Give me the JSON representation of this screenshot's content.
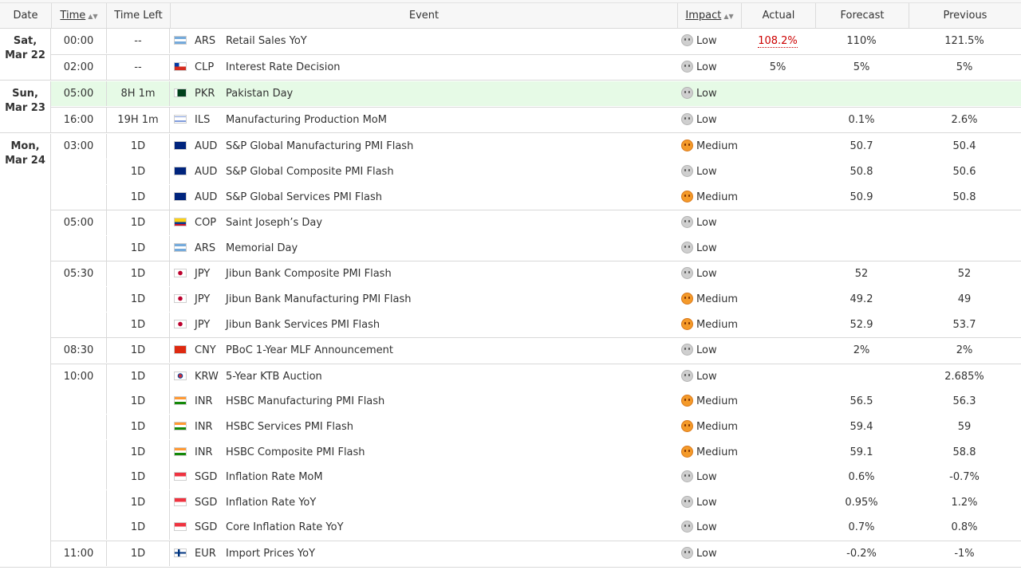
{
  "columns": {
    "date": "Date",
    "time": "Time",
    "time_left": "Time Left",
    "event": "Event",
    "impact": "Impact",
    "actual": "Actual",
    "forecast": "Forecast",
    "previous": "Previous"
  },
  "colors": {
    "highlight_row": "#e6fae6",
    "actual_down": "#cc0000",
    "impact_low": "#cfcfcf",
    "impact_medium": "#f49a2a"
  },
  "groups": [
    {
      "date_line1": "Sat,",
      "date_line2": "Mar 22",
      "times": [
        {
          "time": "00:00",
          "rows": [
            {
              "left": "--",
              "flag": "flag-argentina-icon",
              "cur": "ARS",
              "event": "Retail Sales YoY",
              "impact": "Low",
              "actual": "108.2%",
              "actual_color": "red",
              "forecast": "110%",
              "previous": "121.5%"
            }
          ]
        },
        {
          "time": "02:00",
          "rows": [
            {
              "left": "--",
              "flag": "flag-chile-icon",
              "cur": "CLP",
              "event": "Interest Rate Decision",
              "impact": "Low",
              "actual": "5%",
              "forecast": "5%",
              "previous": "5%"
            }
          ]
        }
      ]
    },
    {
      "date_line1": "Sun,",
      "date_line2": "Mar 23",
      "times": [
        {
          "time": "05:00",
          "highlight": true,
          "rows": [
            {
              "left": "8H 1m",
              "flag": "flag-pakistan-icon",
              "cur": "PKR",
              "event": "Pakistan Day",
              "impact": "Low",
              "actual": "",
              "forecast": "",
              "previous": ""
            }
          ]
        },
        {
          "time": "16:00",
          "rows": [
            {
              "left": "19H 1m",
              "flag": "flag-israel-icon",
              "cur": "ILS",
              "event": "Manufacturing Production MoM",
              "impact": "Low",
              "actual": "",
              "forecast": "0.1%",
              "previous": "2.6%"
            }
          ]
        }
      ]
    },
    {
      "date_line1": "Mon,",
      "date_line2": "Mar 24",
      "times": [
        {
          "time": "03:00",
          "rows": [
            {
              "left": "1D",
              "flag": "flag-australia-icon",
              "cur": "AUD",
              "event": "S&P Global Manufacturing PMI Flash",
              "impact": "Medium",
              "actual": "",
              "forecast": "50.7",
              "previous": "50.4"
            },
            {
              "left": "1D",
              "flag": "flag-australia-icon",
              "cur": "AUD",
              "event": "S&P Global Composite PMI Flash",
              "impact": "Low",
              "actual": "",
              "forecast": "50.8",
              "previous": "50.6"
            },
            {
              "left": "1D",
              "flag": "flag-australia-icon",
              "cur": "AUD",
              "event": "S&P Global Services PMI Flash",
              "impact": "Medium",
              "actual": "",
              "forecast": "50.9",
              "previous": "50.8"
            }
          ]
        },
        {
          "time": "05:00",
          "rows": [
            {
              "left": "1D",
              "flag": "flag-colombia-icon",
              "cur": "COP",
              "event": "Saint Joseph’s Day",
              "impact": "Low",
              "actual": "",
              "forecast": "",
              "previous": ""
            },
            {
              "left": "1D",
              "flag": "flag-argentina-icon",
              "cur": "ARS",
              "event": "Memorial Day",
              "impact": "Low",
              "actual": "",
              "forecast": "",
              "previous": ""
            }
          ]
        },
        {
          "time": "05:30",
          "rows": [
            {
              "left": "1D",
              "flag": "flag-japan-icon",
              "cur": "JPY",
              "event": "Jibun Bank Composite PMI Flash",
              "impact": "Low",
              "actual": "",
              "forecast": "52",
              "previous": "52"
            },
            {
              "left": "1D",
              "flag": "flag-japan-icon",
              "cur": "JPY",
              "event": "Jibun Bank Manufacturing PMI Flash",
              "impact": "Medium",
              "actual": "",
              "forecast": "49.2",
              "previous": "49"
            },
            {
              "left": "1D",
              "flag": "flag-japan-icon",
              "cur": "JPY",
              "event": "Jibun Bank Services PMI Flash",
              "impact": "Medium",
              "actual": "",
              "forecast": "52.9",
              "previous": "53.7"
            }
          ]
        },
        {
          "time": "08:30",
          "rows": [
            {
              "left": "1D",
              "flag": "flag-china-icon",
              "cur": "CNY",
              "event": "PBoC 1-Year MLF Announcement",
              "impact": "Low",
              "actual": "",
              "forecast": "2%",
              "previous": "2%"
            }
          ]
        },
        {
          "time": "10:00",
          "rows": [
            {
              "left": "1D",
              "flag": "flag-south-korea-icon",
              "cur": "KRW",
              "event": "5-Year KTB Auction",
              "impact": "Low",
              "actual": "",
              "forecast": "",
              "previous": "2.685%"
            },
            {
              "left": "1D",
              "flag": "flag-india-icon",
              "cur": "INR",
              "event": "HSBC Manufacturing PMI Flash",
              "impact": "Medium",
              "actual": "",
              "forecast": "56.5",
              "previous": "56.3"
            },
            {
              "left": "1D",
              "flag": "flag-india-icon",
              "cur": "INR",
              "event": "HSBC Services PMI Flash",
              "impact": "Medium",
              "actual": "",
              "forecast": "59.4",
              "previous": "59"
            },
            {
              "left": "1D",
              "flag": "flag-india-icon",
              "cur": "INR",
              "event": "HSBC Composite PMI Flash",
              "impact": "Medium",
              "actual": "",
              "forecast": "59.1",
              "previous": "58.8"
            },
            {
              "left": "1D",
              "flag": "flag-singapore-icon",
              "cur": "SGD",
              "event": "Inflation Rate MoM",
              "impact": "Low",
              "actual": "",
              "forecast": "0.6%",
              "previous": "-0.7%"
            },
            {
              "left": "1D",
              "flag": "flag-singapore-icon",
              "cur": "SGD",
              "event": "Inflation Rate YoY",
              "impact": "Low",
              "actual": "",
              "forecast": "0.95%",
              "previous": "1.2%"
            },
            {
              "left": "1D",
              "flag": "flag-singapore-icon",
              "cur": "SGD",
              "event": "Core Inflation Rate YoY",
              "impact": "Low",
              "actual": "",
              "forecast": "0.7%",
              "previous": "0.8%"
            }
          ]
        },
        {
          "time": "11:00",
          "rows": [
            {
              "left": "1D",
              "flag": "flag-finland-icon",
              "cur": "EUR",
              "event": "Import Prices YoY",
              "impact": "Low",
              "actual": "",
              "forecast": "-0.2%",
              "previous": "-1%"
            }
          ]
        }
      ]
    }
  ]
}
